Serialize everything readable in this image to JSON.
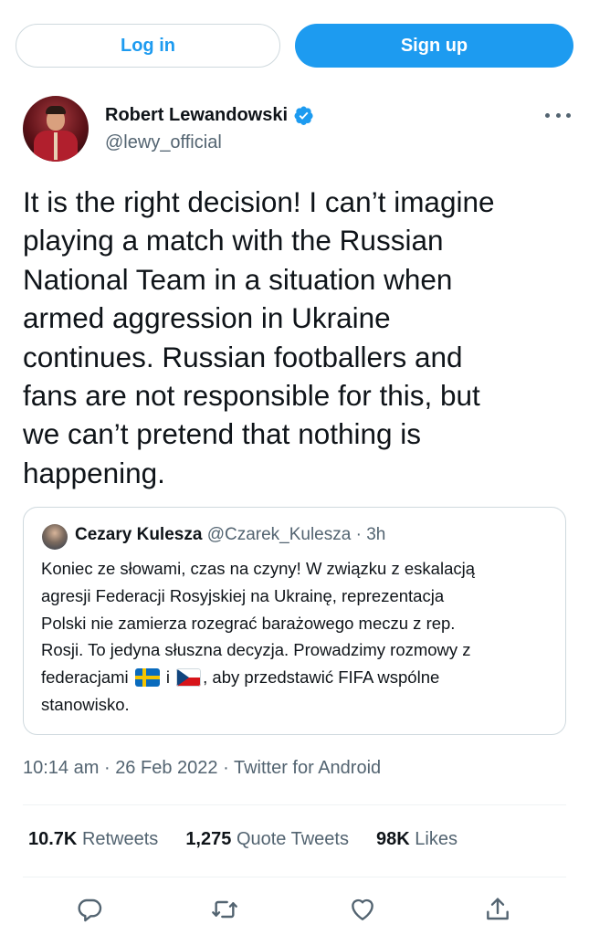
{
  "auth": {
    "login_label": "Log in",
    "signup_label": "Sign up"
  },
  "author": {
    "name": "Robert Lewandowski",
    "handle": "@lewy_official",
    "verified_icon": "verified-badge-icon",
    "more_icon": "more-icon"
  },
  "tweet": {
    "lines": [
      "It is the right decision!  I can’t imagine",
      "playing a match with the Russian",
      "National Team in a situation when",
      "armed aggression in Ukraine",
      "continues.  Russian footballers and",
      "fans are not responsible for this, but",
      "we can’t pretend that nothing is",
      "happening."
    ]
  },
  "quote": {
    "name": "Cezary Kulesza",
    "handle": "@Czarek_Kulesza",
    "separator": "·",
    "time": "3h",
    "lines": [
      "Koniec ze słowami, czas na czyny! W związku z eskalacją",
      "agresji Federacji Rosyjskiej na Ukrainę, reprezentacja",
      "Polski nie zamierza rozegrać barażowego meczu z rep.",
      "Rosji. To jedyna słuszna decyzja. Prowadzimy rozmowy z"
    ],
    "line5_a": "federacjami ",
    "line5_b": " i ",
    "line5_c": ", aby przedstawić FIFA wspólne",
    "line6": "stanowisko."
  },
  "meta": {
    "time": "10:14 am",
    "date": "26 Feb 2022",
    "source": "Twitter for Android",
    "sep": "·"
  },
  "stats": [
    {
      "count": "10.7K",
      "label": "Retweets"
    },
    {
      "count": "1,275",
      "label": "Quote Tweets"
    },
    {
      "count": "98K",
      "label": "Likes"
    }
  ],
  "actions": [
    "reply-icon",
    "retweet-icon",
    "like-icon",
    "share-icon"
  ],
  "colors": {
    "accent": "#1d9bf0",
    "text": "#0f1419",
    "muted": "#536471",
    "border": "#cfd9de"
  }
}
